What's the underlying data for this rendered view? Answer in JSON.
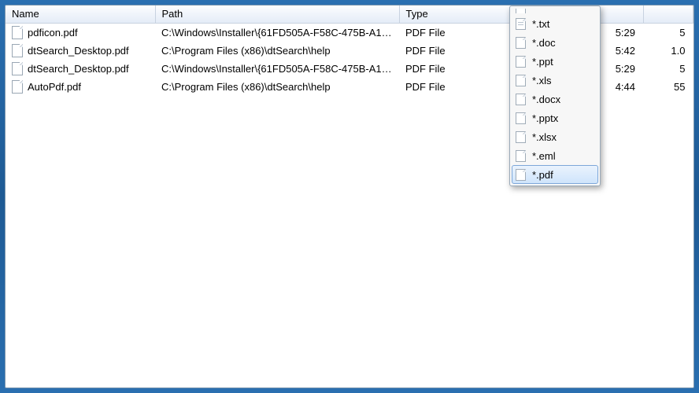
{
  "columns": {
    "name": "Name",
    "path": "Path",
    "type": "Type",
    "time": "",
    "size": ""
  },
  "rows": [
    {
      "name": "pdficon.pdf",
      "path": "C:\\Windows\\Installer\\{61FD505A-F58C-475B-A104...",
      "type": "PDF File",
      "time": "5:29",
      "size": "5"
    },
    {
      "name": "dtSearch_Desktop.pdf",
      "path": "C:\\Program Files (x86)\\dtSearch\\help",
      "type": "PDF File",
      "time": "5:42",
      "size": "1.0"
    },
    {
      "name": "dtSearch_Desktop.pdf",
      "path": "C:\\Windows\\Installer\\{61FD505A-F58C-475B-A104...",
      "type": "PDF File",
      "time": "5:29",
      "size": "5"
    },
    {
      "name": "AutoPdf.pdf",
      "path": "C:\\Program Files (x86)\\dtSearch\\help",
      "type": "PDF File",
      "time": "4:44",
      "size": "55"
    }
  ],
  "dropdown": {
    "items": [
      {
        "label": "*.txt",
        "lines": true
      },
      {
        "label": "*.doc",
        "lines": false
      },
      {
        "label": "*.ppt",
        "lines": false
      },
      {
        "label": "*.xls",
        "lines": false
      },
      {
        "label": "*.docx",
        "lines": false
      },
      {
        "label": "*.pptx",
        "lines": false
      },
      {
        "label": "*.xlsx",
        "lines": false
      },
      {
        "label": "*.eml",
        "lines": false
      },
      {
        "label": "*.pdf",
        "lines": false
      }
    ],
    "selected_index": 8
  }
}
